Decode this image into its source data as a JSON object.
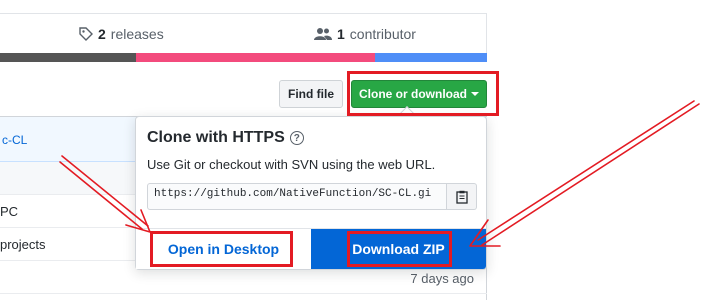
{
  "summary": {
    "releases_count": "2",
    "releases_label": "releases",
    "contributors_count": "1",
    "contributors_label": "contributor"
  },
  "language_bar": [
    {
      "color": "#555555",
      "share": 28
    },
    {
      "color": "#f34b7d",
      "share": 49
    },
    {
      "color": "#4f8ef7",
      "share": 23
    }
  ],
  "file_table": {
    "commit_text": "c-CL",
    "rows": [
      "",
      "PC",
      "projects",
      ""
    ],
    "age": "7 days ago"
  },
  "toolbar": {
    "find_file_label": "Find file",
    "clone_label": "Clone or download"
  },
  "dropdown": {
    "title": "Clone with HTTPS",
    "help_icon": "?",
    "description": "Use Git or checkout with SVN using the web URL.",
    "url": "https://github.com/NativeFunction/SC-CL.gi",
    "open_desktop_label": "Open in Desktop",
    "download_zip_label": "Download ZIP"
  },
  "annotation_color": "#e31b23"
}
